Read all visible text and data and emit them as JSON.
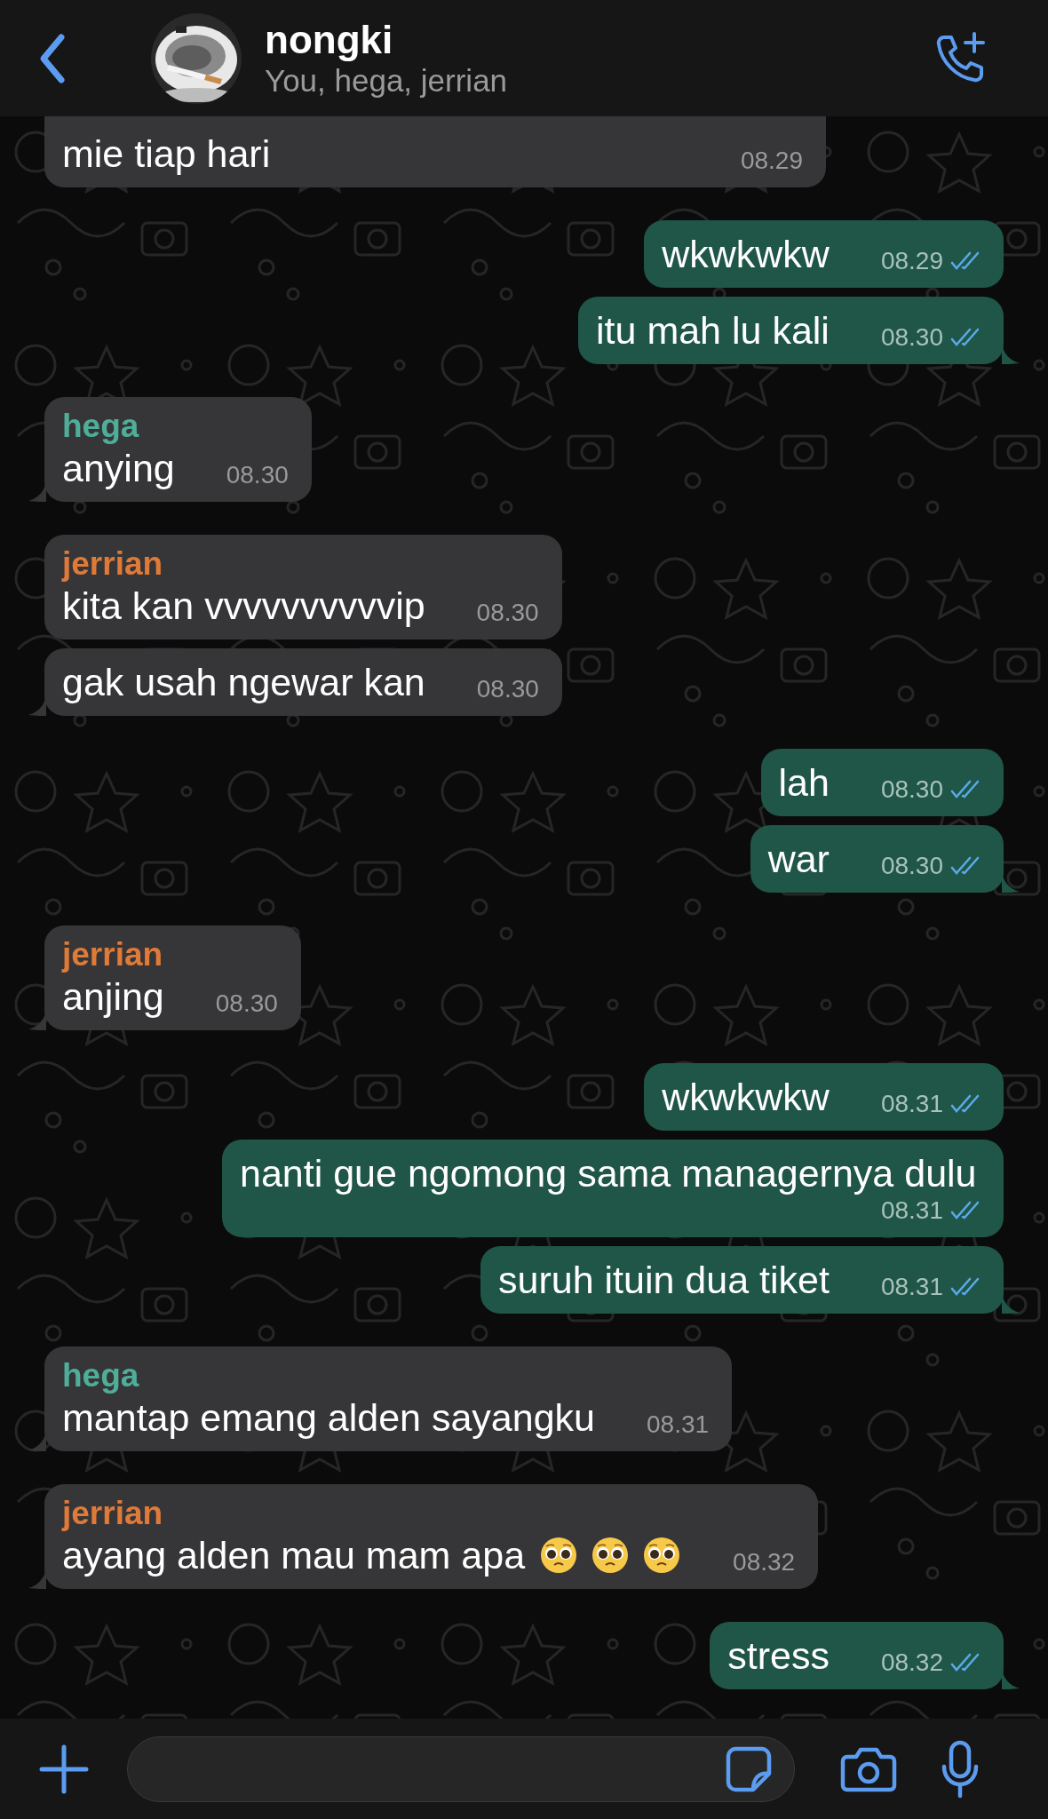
{
  "header": {
    "title": "nongki",
    "subtitle": "You, hega, jerrian"
  },
  "messages": [
    {
      "kind": "incoming",
      "cut": true,
      "text": "mie tiap hari",
      "time": "08.29",
      "tail": false
    },
    {
      "kind": "outgoing",
      "text": "wkwkwkw",
      "time": "08.29",
      "read": true,
      "tail": false
    },
    {
      "kind": "outgoing",
      "text": "itu mah lu kali",
      "time": "08.30",
      "read": true,
      "tail": true
    },
    {
      "kind": "incoming",
      "sender": {
        "name": "hega",
        "color": "#4fae9a"
      },
      "text": "anying",
      "time": "08.30",
      "tail": true
    },
    {
      "kind": "incoming",
      "sender": {
        "name": "jerrian",
        "color": "#e07a38"
      },
      "text": "kita kan vvvvvvvvvvip",
      "time": "08.30",
      "tail": false
    },
    {
      "kind": "incoming",
      "text": "gak usah ngewar kan",
      "time": "08.30",
      "tail": true
    },
    {
      "kind": "outgoing",
      "text": "lah",
      "time": "08.30",
      "read": true,
      "tail": false
    },
    {
      "kind": "outgoing",
      "text": "war",
      "time": "08.30",
      "read": true,
      "tail": true
    },
    {
      "kind": "incoming",
      "sender": {
        "name": "jerrian",
        "color": "#e07a38"
      },
      "text": "anjing",
      "time": "08.30",
      "tail": true
    },
    {
      "kind": "outgoing",
      "text": "wkwkwkw",
      "time": "08.31",
      "read": true,
      "tail": false
    },
    {
      "kind": "outgoing",
      "text": "nanti gue ngomong sama managernya dulu",
      "time": "08.31",
      "read": true,
      "tail": false
    },
    {
      "kind": "outgoing",
      "text": "suruh ituin dua tiket",
      "time": "08.31",
      "read": true,
      "tail": true
    },
    {
      "kind": "incoming",
      "sender": {
        "name": "hega",
        "color": "#4fae9a"
      },
      "text": "mantap emang alden sayangku",
      "time": "08.31",
      "tail": true
    },
    {
      "kind": "incoming",
      "sender": {
        "name": "jerrian",
        "color": "#e07a38"
      },
      "text": "ayang alden mau mam apa",
      "emojis": [
        {
          "kind": "pleading-face"
        },
        {
          "kind": "pleading-face"
        },
        {
          "kind": "pleading-face"
        }
      ],
      "time": "08.32",
      "tail": true
    },
    {
      "kind": "outgoing",
      "text": "stress",
      "time": "08.32",
      "read": true,
      "tail": true
    }
  ]
}
